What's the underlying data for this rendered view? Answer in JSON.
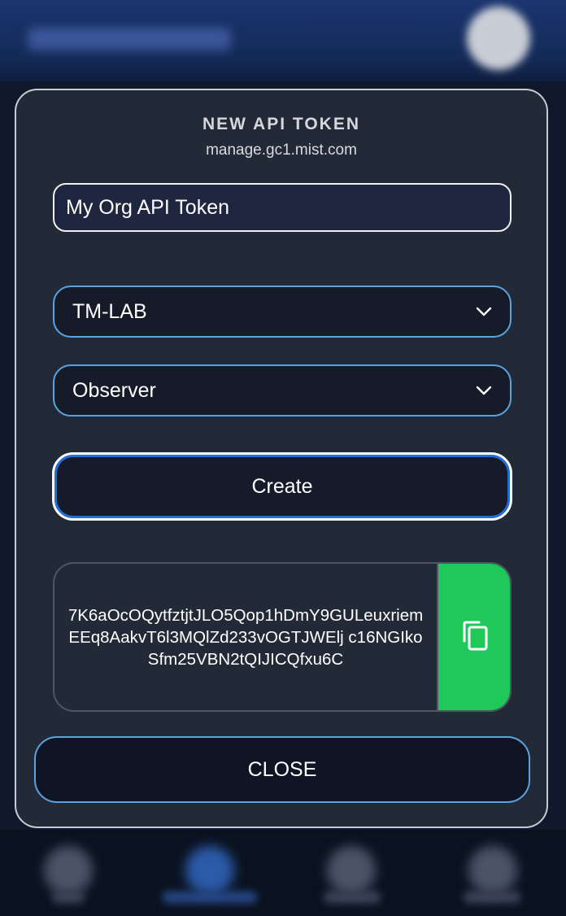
{
  "modal": {
    "title": "NEW API TOKEN",
    "subtitle": "manage.gc1.mist.com",
    "token_name": {
      "value": "My Org API Token"
    },
    "org_select": {
      "selected": "TM-LAB"
    },
    "role_select": {
      "selected": "Observer"
    },
    "create_label": "Create",
    "token_value": "7K6aOcOQytfztjtJLO5Qop1hDmY9GULeuxriemEEq8AakvT6l3MQlZd233vOGTJWElj c16NGIkoSfm25VBN2tQIJICQfxu6C",
    "close_label": "CLOSE"
  },
  "colors": {
    "modal_bg": "#232a37",
    "field_border_accent": "#5aa3df",
    "copy_button_bg": "#1ec95a",
    "create_focus_ring": "#1f6fd6"
  },
  "icons": {
    "copy": "copy-icon",
    "org_dropdown": "chevron-down-icon",
    "role_dropdown": "chevron-down-icon"
  }
}
